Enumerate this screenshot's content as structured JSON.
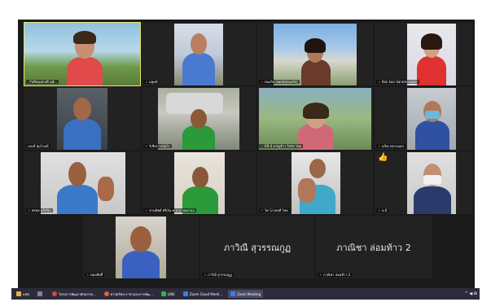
{
  "participants": [
    {
      "name": "ศรีทนงค์ ศรีวงศ์...",
      "active": true
    },
    {
      "name": "มหุดต์"
    },
    {
      "name": "ทนงกิจ รอดภัย(ทนงกิจ)"
    },
    {
      "name": "Kan kan Saramongkol"
    },
    {
      "name": "เบนซ์ ปุ่มโบลด์"
    },
    {
      "name": "วิเชียร วงษ์อุไร"
    },
    {
      "name": "KR-4 ขวัญข้าว ไซรัส ไทย"
    },
    {
      "name": "อภิณ พลวงนอก"
    },
    {
      "name": "ศรพล ศรีเขียว"
    },
    {
      "name": "ชานทิพย์ ศรีเงิน ค.ธ.ป. ทองกลม"
    },
    {
      "name": "ไพ โภวพรดี ไทย"
    },
    {
      "name": "อ.บี"
    },
    {
      "name": "หมอสิทธิ์"
    },
    {
      "name": "ภาวิณี สุวรรณกูฏ",
      "big": "ภาวิณี สุวรรณกูฏ"
    },
    {
      "name": "ภาณิชา ล่อมท้าว 2",
      "big": "ภาณิชา ล่อมท้าว 2"
    }
  ],
  "reaction": "👍",
  "taskbar": {
    "items": [
      {
        "label": "แชท",
        "color": "#e8b040"
      },
      {
        "label": "",
        "color": "#8080a0"
      },
      {
        "label": "โครงการพัฒนาศักยภาพ...",
        "color": "#d04a3a"
      },
      {
        "label": "ศาสตร์พระราชาและการพัฒ...",
        "color": "#e0603a"
      },
      {
        "label": "LINE",
        "color": "#2fb34a"
      },
      {
        "label": "Zoom Cloud Meeti...",
        "color": "#3a7de0"
      },
      {
        "label": "Zoom Meeting",
        "color": "#3a7de0",
        "active": true
      }
    ],
    "tray": "^ ◀ ⊞"
  }
}
